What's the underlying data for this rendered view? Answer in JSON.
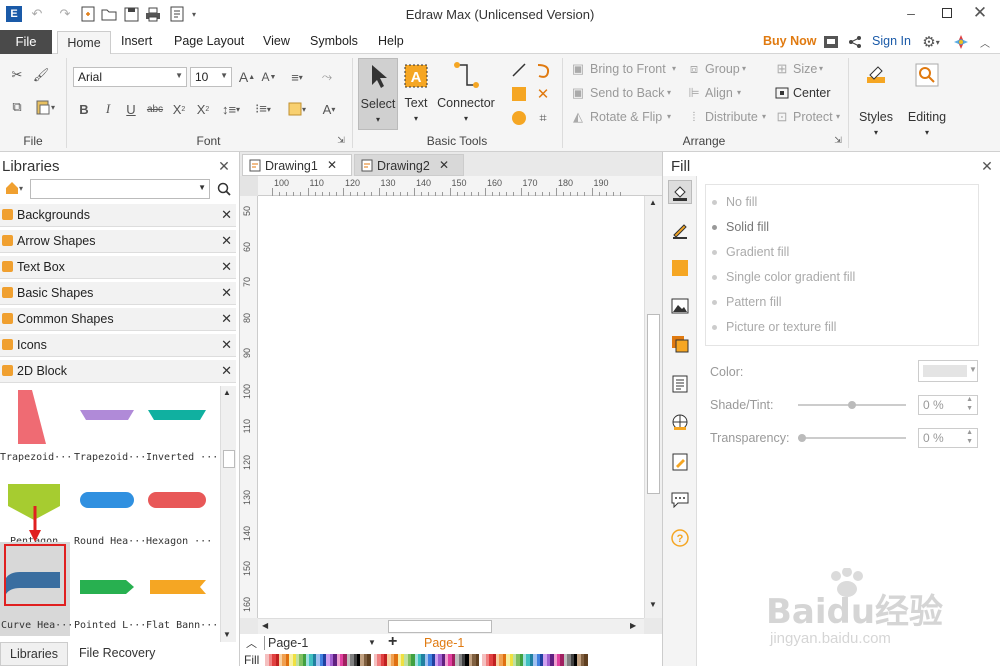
{
  "window": {
    "title": "Edraw Max (Unlicensed Version)"
  },
  "menu": {
    "file": "File",
    "home": "Home",
    "insert": "Insert",
    "page_layout": "Page Layout",
    "view": "View",
    "symbols": "Symbols",
    "help": "Help",
    "buy_now": "Buy Now",
    "sign_in": "Sign In"
  },
  "ribbon": {
    "file_group": "File",
    "font_group": "Font",
    "font_name": "Arial",
    "font_size": "10",
    "basic_tools_group": "Basic Tools",
    "select": "Select",
    "text": "Text",
    "connector": "Connector",
    "arrange_group": "Arrange",
    "bring_to_front": "Bring to Front",
    "send_to_back": "Send to Back",
    "rotate_flip": "Rotate & Flip",
    "group": "Group",
    "align": "Align",
    "distribute": "Distribute",
    "size": "Size",
    "center": "Center",
    "protect": "Protect",
    "styles": "Styles",
    "editing": "Editing"
  },
  "libraries": {
    "title": "Libraries",
    "items": [
      "Backgrounds",
      "Arrow Shapes",
      "Text Box",
      "Basic Shapes",
      "Common Shapes",
      "Icons",
      "2D Block"
    ],
    "shapes": [
      "Trapezoid···",
      "Trapezoid···",
      "Inverted ···",
      "Pentagon",
      "Round Hea···",
      "Hexagon ···",
      "Curve Hea···",
      "Pointed L···",
      "Flat Bann···"
    ],
    "bottom_tabs": [
      "Libraries",
      "File Recovery"
    ]
  },
  "tabs": [
    "Drawing1",
    "Drawing2"
  ],
  "ruler": {
    "h": [
      "100",
      "110",
      "120",
      "130",
      "140",
      "150",
      "160",
      "170",
      "180",
      "190"
    ],
    "v": [
      "50",
      "60",
      "70",
      "80",
      "90",
      "100",
      "110",
      "120",
      "130",
      "140",
      "150",
      "160"
    ]
  },
  "pages": {
    "current": "Page-1",
    "tab": "Page-1"
  },
  "fill_bar_label": "Fill",
  "fill": {
    "title": "Fill",
    "options": [
      "No fill",
      "Solid fill",
      "Gradient fill",
      "Single color gradient fill",
      "Pattern fill",
      "Picture or texture fill"
    ],
    "color_label": "Color:",
    "shade_label": "Shade/Tint:",
    "shade_value": "0 %",
    "transparency_label": "Transparency:",
    "transparency_value": "0 %"
  },
  "watermark": {
    "text": "Baidu经验",
    "sub": "jingyan.baidu.com"
  },
  "colors": {
    "accent_orange": "#e07a10",
    "selection_red": "#e02020"
  }
}
